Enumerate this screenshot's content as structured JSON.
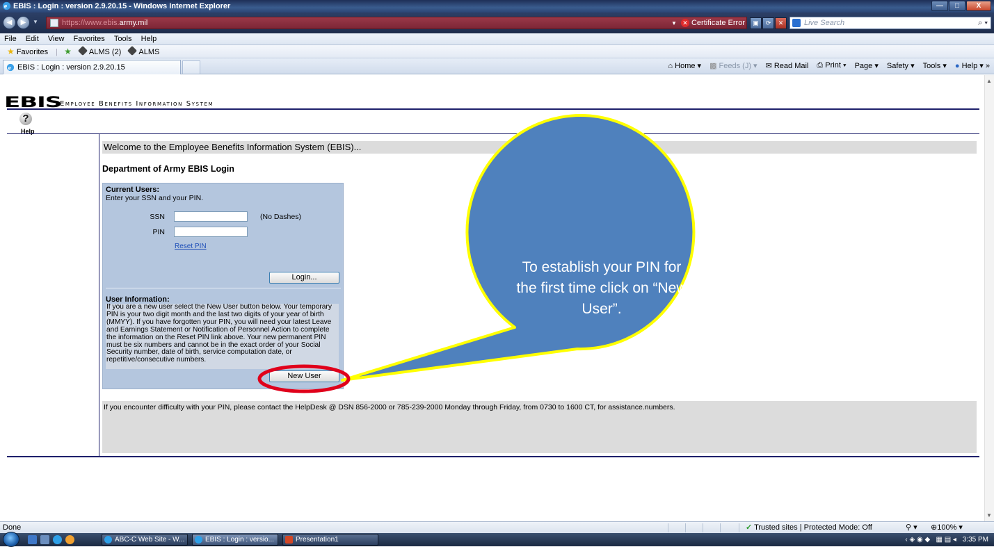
{
  "window": {
    "title": "EBIS : Login : version 2.9.20.15 - Windows Internet Explorer",
    "minimize": "—",
    "maximize": "□",
    "close": "X"
  },
  "address": {
    "url_faded": "https://www.ebis.",
    "url_bold": "army.mil",
    "cert_error": "Certificate Error",
    "search_placeholder": "Live Search"
  },
  "menu": [
    "File",
    "Edit",
    "View",
    "Favorites",
    "Tools",
    "Help"
  ],
  "favorites": {
    "label": "Favorites",
    "items": [
      "ALMS (2)",
      "ALMS"
    ]
  },
  "tab": {
    "title": "EBIS : Login : version 2.9.20.15"
  },
  "commands": {
    "home": "Home",
    "feeds": "Feeds (J)",
    "read_mail": "Read Mail",
    "print": "Print",
    "page": "Page",
    "safety": "Safety",
    "tools": "Tools",
    "help": "Help"
  },
  "page": {
    "logo_word": "EBIS",
    "logo_sub": "Employee Benefits Information System",
    "help_label": "Help",
    "welcome": "Welcome to the Employee Benefits Information System (EBIS)...",
    "dept_title": "Department of Army EBIS Login",
    "current_users_title": "Current Users:",
    "current_users_instr": "Enter your SSN and your PIN.",
    "ssn_label": "SSN",
    "pin_label": "PIN",
    "no_dashes": "(No Dashes)",
    "reset_pin": "Reset PIN",
    "login_button": "Login...",
    "user_info_title": "User Information:",
    "user_info_text": "If you are a new user select the New User button below. Your temporary PIN is your two digit month and the last two digits of your year of birth (MMYY). If you have forgotten your PIN, you will need your latest Leave and Earnings Statement or Notification of Personnel Action to complete the information on the Reset PIN link above. Your new permanent PIN must be six numbers and cannot be in the exact order of your Social Security number, date of birth, service computation date, or repetitive/consecutive numbers.",
    "new_user_button": "New User",
    "helpdesk_text": "If you encounter difficulty with your PIN, please contact the HelpDesk @ DSN 856-2000 or 785-239-2000 Monday through Friday, from 0730 to 1600 CT, for assistance.numbers."
  },
  "callout": {
    "text": "To establish your PIN for the first time click on “New User”."
  },
  "status": {
    "done": "Done",
    "zone": "Trusted sites | Protected Mode: Off",
    "zoom": "100%"
  },
  "taskbar": {
    "buttons": [
      "ABC-C Web Site - W...",
      "EBIS : Login : versio...",
      "Presentation1"
    ],
    "time": "3:35 PM"
  },
  "colors": {
    "callout_fill": "#4f81bd",
    "callout_border": "#ffff00",
    "highlight_ring": "#e0001b",
    "login_panel": "#b4c6de",
    "rule": "#1d1f6b"
  }
}
